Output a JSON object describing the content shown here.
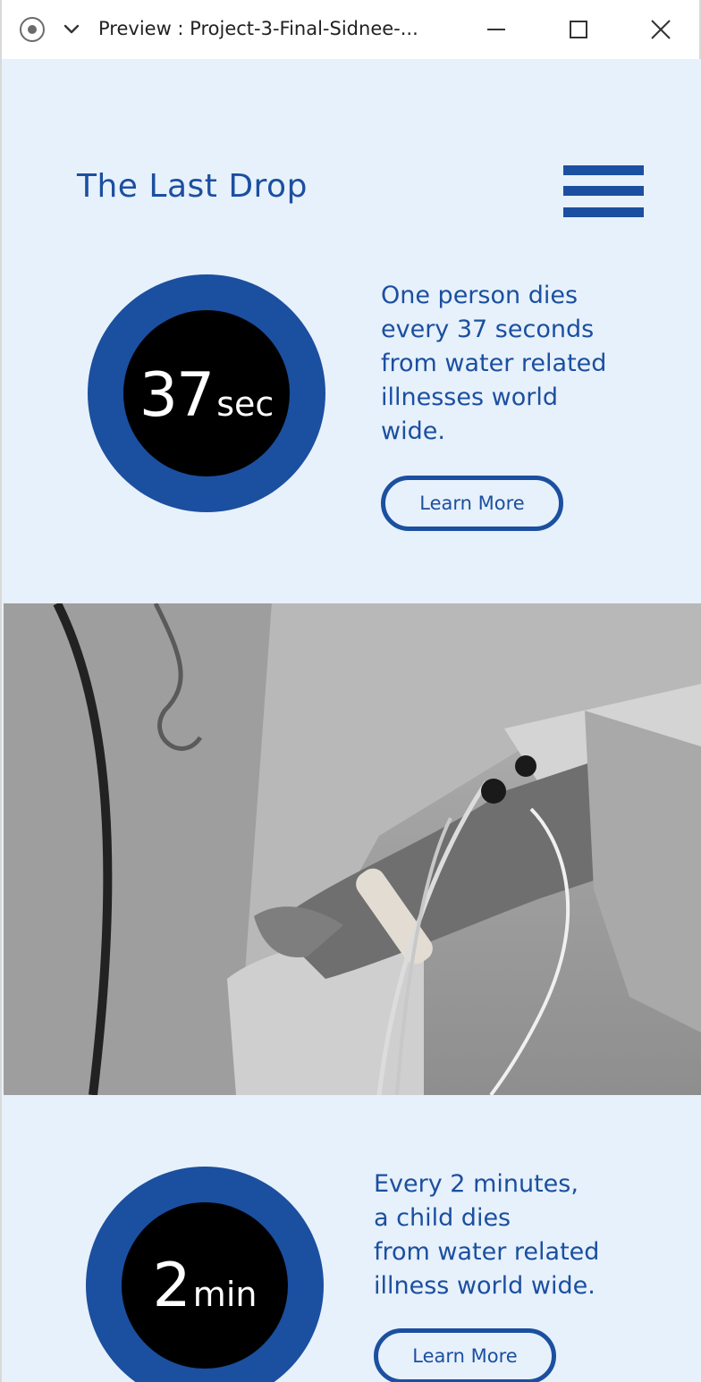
{
  "window": {
    "title": "Preview : Project-3-Final-Sidnee-..."
  },
  "header": {
    "brand": "The Last Drop",
    "menu_icon": "hamburger-menu-icon"
  },
  "stats": [
    {
      "number": "37",
      "unit": "sec",
      "text": "One person dies\nevery 37 seconds\nfrom water related\nillnesses world\nwide.",
      "button": "Learn More"
    },
    {
      "number": "2",
      "unit": "min",
      "text": "Every 2 minutes,\na child dies\nfrom water related\nillness world wide.",
      "button": "Learn More"
    }
  ],
  "photo": {
    "icon": "hospital-iv-hand-photo"
  },
  "colors": {
    "accent": "#1b4fa0",
    "background": "#e7f1fb",
    "circle_center": "#000000"
  }
}
